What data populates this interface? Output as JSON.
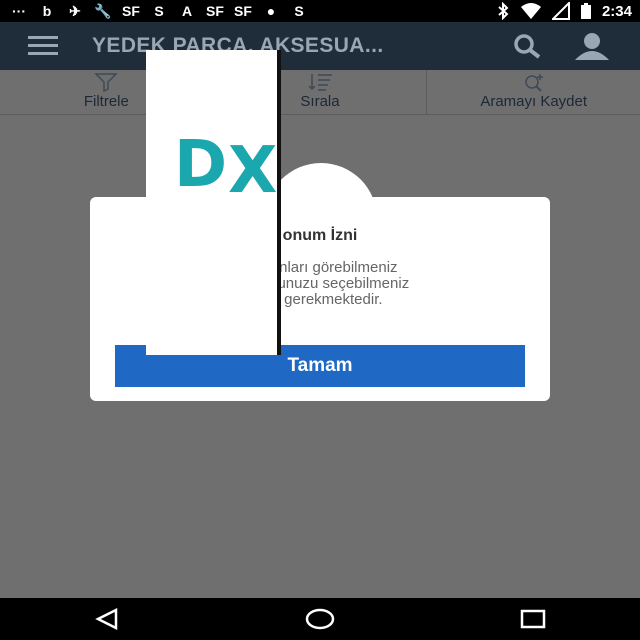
{
  "status_bar": {
    "left_icons": [
      "chat-icon",
      "b-app-icon",
      "bird-icon",
      "wrench-icon",
      "sf-app-icon",
      "s-app-icon",
      "a-app-icon",
      "sf-app-icon",
      "sf-app-icon",
      "sf-app-icon",
      "s-app-icon"
    ],
    "left_glyphs": [
      "···",
      "b",
      "✈",
      "🔧",
      "SF",
      "S",
      "A",
      "SF",
      "SF",
      "●",
      "S"
    ],
    "right_icons": [
      "bluetooth-icon",
      "wifi-icon",
      "signal-icon",
      "battery-icon"
    ],
    "time": "2:34"
  },
  "app_bar": {
    "title": "YEDEK PARÇA, AKSESUA..."
  },
  "toolbar": {
    "filter_label": "Filtrele",
    "sort_label": "Sırala",
    "save_search_label": "Aramayı Kaydet"
  },
  "dialog": {
    "title": "onum İzni",
    "line1": "- n ilanları görebilmeniz",
    "line2": "- İ numunuzu seçebilmeniz",
    "line3": "izni gerekmektedir.",
    "ok_label": "Tamam"
  },
  "overlay": {
    "letter1": "D",
    "letter2": "X"
  },
  "colors": {
    "appbar": "#1f2c3a",
    "button": "#1f68c3",
    "overlay_letters": "#1aa7ad"
  }
}
